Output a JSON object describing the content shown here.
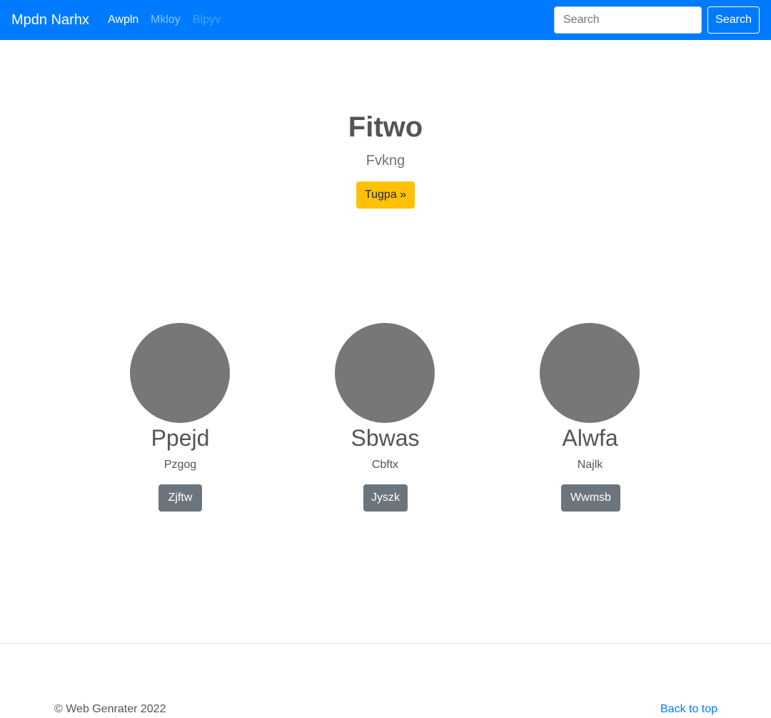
{
  "navbar": {
    "brand": "Mpdn Narhx",
    "links": [
      {
        "label": "Awpln",
        "state": "active"
      },
      {
        "label": "Mkloy",
        "state": "normal"
      },
      {
        "label": "Blpyv",
        "state": "disabled"
      }
    ],
    "search": {
      "placeholder": "Search",
      "value": "",
      "button_label": "Search"
    },
    "color": "#007bff"
  },
  "hero": {
    "title": "Fitwo",
    "subtitle": "Fvkng",
    "button_label": "Tugpa »",
    "button_color": "#ffc107"
  },
  "features": [
    {
      "title": "Ppejd",
      "text": "Pzgog",
      "button_label": "Zjftw"
    },
    {
      "title": "Sbwas",
      "text": "Cbftx",
      "button_label": "Jyszk"
    },
    {
      "title": "Alwfa",
      "text": "Najlk",
      "button_label": "Wwmsb"
    }
  ],
  "footer": {
    "copyright": "© Web Genrater 2022",
    "back_to_top": "Back to top"
  }
}
